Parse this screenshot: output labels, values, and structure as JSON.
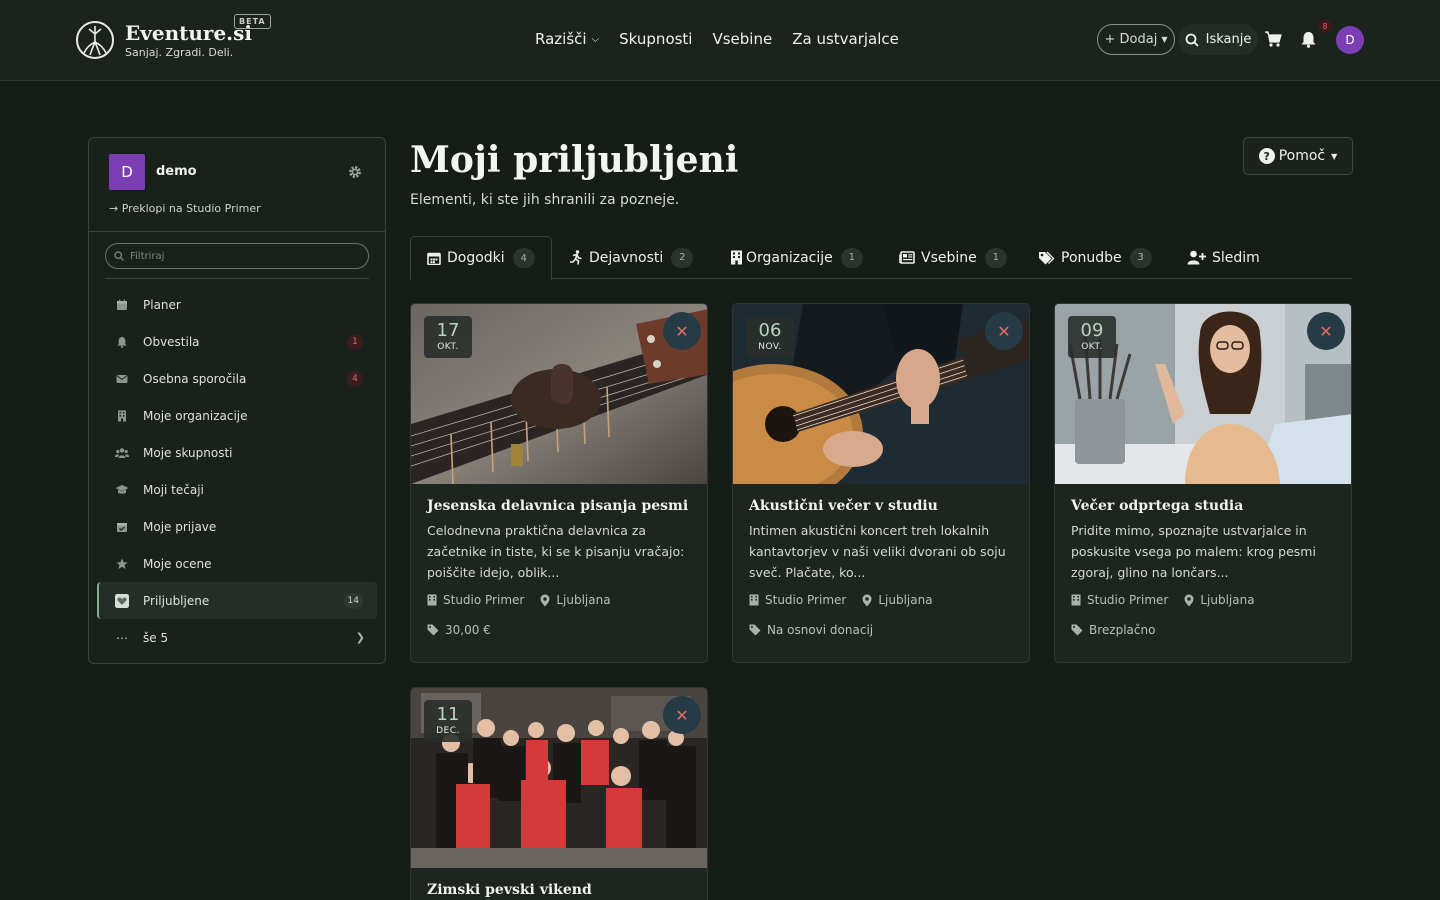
{
  "brand": {
    "name": "Eventure.si",
    "tagline": "Sanjaj. Zgradi. Deli.",
    "beta": "BETA"
  },
  "nav": {
    "items": [
      "Razišči",
      "Skupnosti",
      "Vsebine",
      "Za ustvarjalce"
    ]
  },
  "header": {
    "add_label": "+ Dodaj",
    "search_label": "Iskanje",
    "notif_count": "8",
    "avatar": "D"
  },
  "sidebar": {
    "avatar": "D",
    "username": "demo",
    "switch_label": "Preklopi na Studio Primer",
    "filter_placeholder": "Filtriraj",
    "items": [
      {
        "label": "Planer",
        "icon": "calendar-icon",
        "badge": ""
      },
      {
        "label": "Obvestila",
        "icon": "bell-icon",
        "badge": "1"
      },
      {
        "label": "Osebna sporočila",
        "icon": "envelope-icon",
        "badge": "4"
      },
      {
        "label": "Moje organizacije",
        "icon": "building-icon",
        "badge": ""
      },
      {
        "label": "Moje skupnosti",
        "icon": "users-icon",
        "badge": ""
      },
      {
        "label": "Moji tečaji",
        "icon": "graduation-cap-icon",
        "badge": ""
      },
      {
        "label": "Moje prijave",
        "icon": "calendar-check-icon",
        "badge": ""
      },
      {
        "label": "Moje ocene",
        "icon": "star-icon",
        "badge": ""
      },
      {
        "label": "Priljubljene",
        "icon": "heart-icon",
        "badge": "14"
      },
      {
        "label": "še 5",
        "icon": "ellipsis-icon",
        "badge": ""
      }
    ]
  },
  "page": {
    "title": "Moji priljubljeni",
    "subtitle": "Elementi, ki ste jih shranili za pozneje.",
    "help_label": "Pomoč"
  },
  "tabs": [
    {
      "label": "Dogodki",
      "count": "4",
      "icon": "calendar-icon"
    },
    {
      "label": "Dejavnosti",
      "count": "2",
      "icon": "running-icon"
    },
    {
      "label": "Organizacije",
      "count": "1",
      "icon": "building-icon"
    },
    {
      "label": "Vsebine",
      "count": "1",
      "icon": "newspaper-icon"
    },
    {
      "label": "Ponudbe",
      "count": "3",
      "icon": "tags-icon"
    },
    {
      "label": "Sledim",
      "count": "",
      "icon": "user-plus-icon"
    }
  ],
  "cards": [
    {
      "day": "17",
      "month": "OKT.",
      "title": "Jesenska delavnica pisanja pesmi",
      "desc": "Celodnevna praktična delavnica za začetnike in tiste, ki se k pisanju vračajo: poiščite idejo, oblik...",
      "org": "Studio Primer",
      "city": "Ljubljana",
      "price": "30,00 €"
    },
    {
      "day": "06",
      "month": "NOV.",
      "title": "Akustični večer v studiu",
      "desc": "Intimen akustični koncert treh lokalnih kantavtorjev v naši veliki dvorani ob soju sveč. Plačate, ko...",
      "org": "Studio Primer",
      "city": "Ljubljana",
      "price": "Na osnovi donacij"
    },
    {
      "day": "09",
      "month": "OKT.",
      "title": "Večer odprtega studia",
      "desc": "Pridite mimo, spoznajte ustvarjalce in poskusite vsega po malem: krog pesmi zgoraj, glino na lončars...",
      "org": "Studio Primer",
      "city": "Ljubljana",
      "price": "Brezplačno"
    },
    {
      "day": "11",
      "month": "DEC.",
      "title": "Zimski pevski vikend",
      "desc": "",
      "org": "",
      "city": "",
      "price": ""
    }
  ],
  "colors": {
    "background": "#161c18",
    "accent": "#7fb08a",
    "avatar": "#7b3fb3",
    "danger": "#e46a6a"
  }
}
